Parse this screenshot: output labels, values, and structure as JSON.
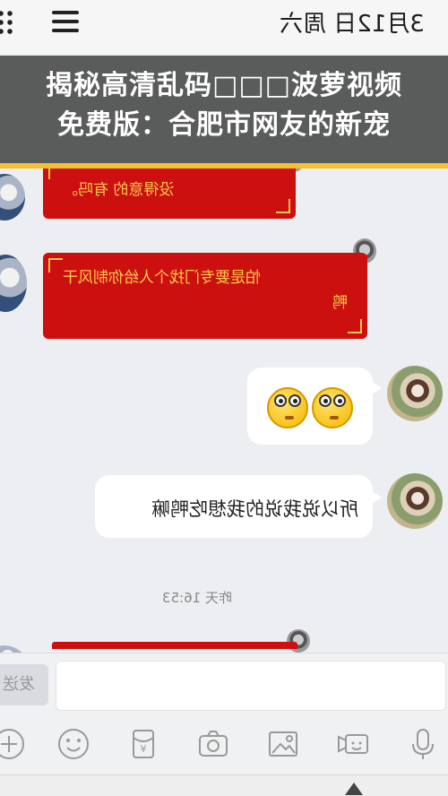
{
  "status_bar": {
    "date": "3月12日 周六"
  },
  "banner": {
    "line1": "揭秘高清乱码□□□波萝视频",
    "line2": "免费版：合肥市网友的新宠"
  },
  "messages": {
    "card1": "没得意的  有吗。",
    "card2_line1": "怕是要专门找个人给你制风干",
    "card2_line2": "鸭",
    "bubble_text": "所以说我说的我想吃鸭嘛",
    "timestamp": "昨天 16:53"
  },
  "input": {
    "send_label": "发送"
  },
  "icons": [
    "plus-icon",
    "emoji-icon",
    "red-packet-icon",
    "camera-icon",
    "image-icon",
    "video-icon",
    "microphone-icon"
  ]
}
